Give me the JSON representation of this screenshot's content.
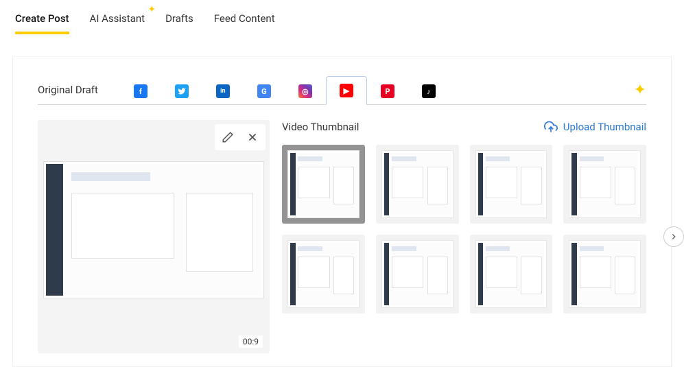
{
  "topnav": {
    "items": [
      {
        "label": "Create Post",
        "active": true
      },
      {
        "label": "AI Assistant",
        "sparkle": true
      },
      {
        "label": "Drafts"
      },
      {
        "label": "Feed Content"
      }
    ]
  },
  "tabs": {
    "label": "Original Draft",
    "networks": [
      {
        "name": "facebook",
        "bg": "#1877f2",
        "glyph": "f"
      },
      {
        "name": "twitter",
        "bg": "#1da1f2",
        "glyph": "t"
      },
      {
        "name": "linkedin",
        "bg": "#0a66c2",
        "glyph": "in"
      },
      {
        "name": "google",
        "bg": "#4285f4",
        "glyph": "G"
      },
      {
        "name": "instagram",
        "bg": "linear-gradient(45deg,#f58529,#dd2a7b,#8134af,#515bd4)",
        "glyph": "◎"
      },
      {
        "name": "youtube",
        "bg": "#ff0000",
        "glyph": "▶",
        "active": true
      },
      {
        "name": "pinterest",
        "bg": "#e60023",
        "glyph": "P"
      },
      {
        "name": "tiktok",
        "bg": "#000000",
        "glyph": "♪"
      }
    ]
  },
  "video": {
    "duration": "00:9"
  },
  "thumbnails": {
    "title": "Video Thumbnail",
    "upload_label": "Upload Thumbnail",
    "count": 8,
    "selected_index": 0
  },
  "colors": {
    "accent": "#ffcc00",
    "link": "#2979d6"
  }
}
